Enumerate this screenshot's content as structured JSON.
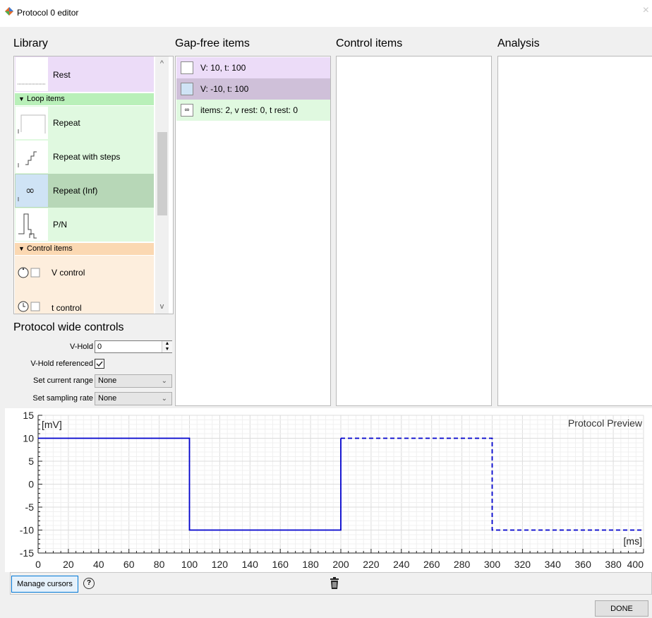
{
  "window": {
    "title": "Protocol 0 editor",
    "close_glyph": "×",
    "icon": "diamond-app-icon"
  },
  "sections": {
    "library": "Library",
    "gap_free": "Gap-free items",
    "control": "Control items",
    "analysis": "Analysis",
    "protocol_wide": "Protocol wide controls"
  },
  "library": {
    "rest_label": "Rest",
    "loop_header": "Loop items",
    "repeat_label": "Repeat",
    "repeat_steps_label": "Repeat with steps",
    "repeat_inf_label": "Repeat (Inf)",
    "pn_label": "P/N",
    "control_header": "Control items",
    "v_control_label": "V control",
    "t_control_label": "t control"
  },
  "gap_free_items": [
    {
      "text": "V: 10, t: 100"
    },
    {
      "text": "V: -10, t: 100"
    },
    {
      "text": "items: 2, v rest: 0, t rest: 0"
    }
  ],
  "controls": {
    "vhold_label": "V-Hold",
    "vhold_value": "0",
    "vhold_ref_label": "V-Hold referenced",
    "vhold_ref_checked": true,
    "current_range_label": "Set current range",
    "current_range_value": "None",
    "sampling_label": "Set sampling rate",
    "sampling_value": "None"
  },
  "chart_data": {
    "type": "line",
    "title": "Protocol Preview",
    "ylabel": "[mV]",
    "xlabel": "[ms]",
    "xlim": [
      0,
      400
    ],
    "ylim": [
      -15,
      15
    ],
    "xticks": [
      0,
      20,
      40,
      60,
      80,
      100,
      120,
      140,
      160,
      180,
      200,
      220,
      240,
      260,
      280,
      300,
      320,
      340,
      360,
      380,
      400
    ],
    "yticks": [
      15,
      10,
      5,
      0,
      -5,
      -10,
      -15
    ],
    "grid": true,
    "series": [
      {
        "style": "solid",
        "color": "#0000cc",
        "x": [
          0,
          100,
          100,
          200,
          200
        ],
        "y": [
          10,
          10,
          -10,
          -10,
          10
        ]
      },
      {
        "style": "dashed",
        "color": "#0000cc",
        "x": [
          200,
          300,
          300,
          400
        ],
        "y": [
          10,
          10,
          -10,
          -10
        ]
      }
    ]
  },
  "footer": {
    "manage_cursors": "Manage cursors",
    "help_glyph": "?",
    "trash_icon": "trash-icon",
    "done": "DONE"
  },
  "colors": {
    "rest_bg": "#ecdcf8",
    "loop_bg": "#e0f9e0",
    "loop_header_bg": "#b9f0b9",
    "selected_loop_bg": "#b7d7b7",
    "control_bg": "#fdeedd",
    "control_header_bg": "#fbd8b2",
    "gap_item1_bg": "#ecdcf8",
    "gap_item2_bg": "#cfc0d9",
    "gap_item3_bg": "#e0f9e0"
  }
}
